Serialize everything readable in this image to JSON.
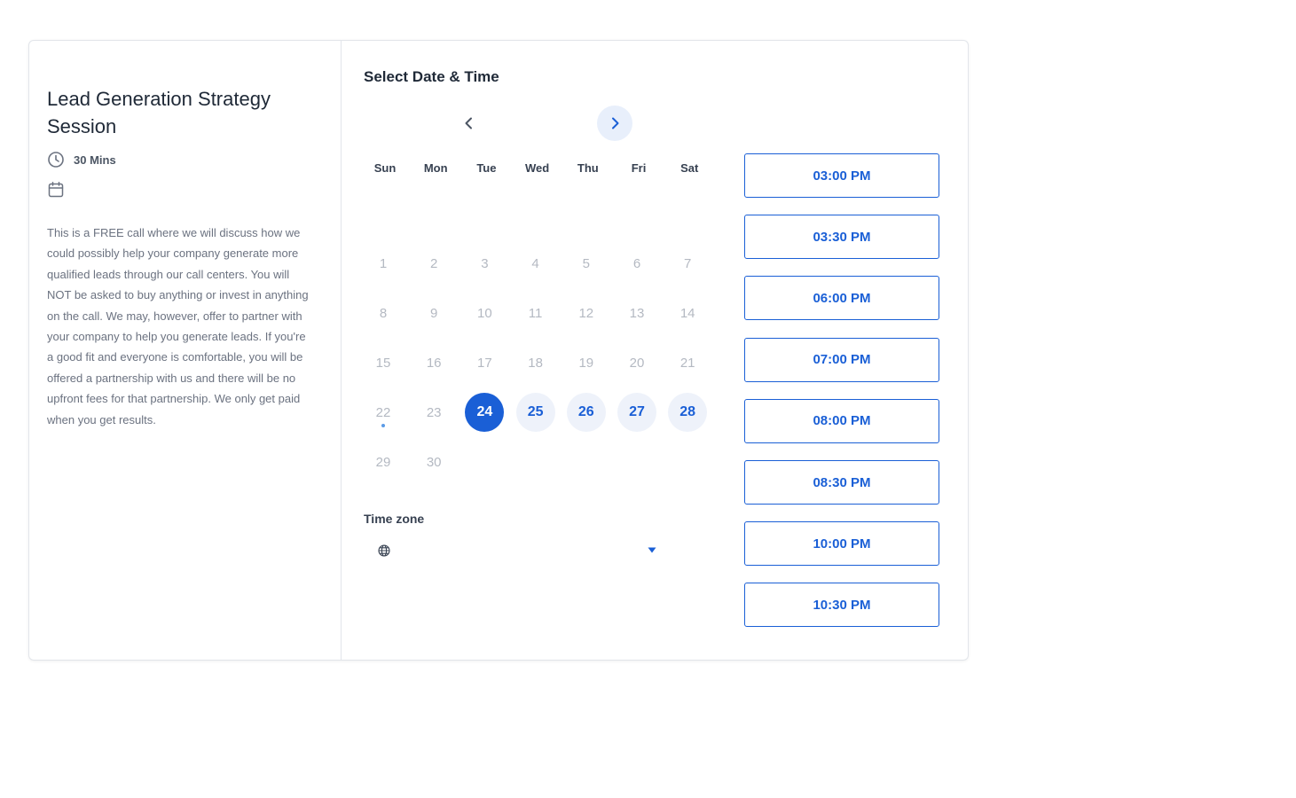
{
  "event": {
    "title": "Lead Generation Strategy Session",
    "duration": "30 Mins",
    "description": "This is a FREE call where we will discuss how we could possibly help your company generate more qualified leads through our call centers. You will NOT be asked to buy anything or invest in anything on the call. We may, however, offer to partner with your company to help you generate leads. If you're a good fit and everyone is comfortable, you will be offered a partnership with us and there will be no upfront fees for that partnership. We only get paid when you get results."
  },
  "scheduler": {
    "title": "Select Date & Time",
    "prev_icon": "chevron-left-icon",
    "next_icon": "chevron-right-icon"
  },
  "calendar": {
    "weekdays": [
      "Sun",
      "Mon",
      "Tue",
      "Wed",
      "Thu",
      "Fri",
      "Sat"
    ],
    "days": [
      "1",
      "2",
      "3",
      "4",
      "5",
      "6",
      "7",
      "8",
      "9",
      "10",
      "11",
      "12",
      "13",
      "14",
      "15",
      "16",
      "17",
      "18",
      "19",
      "20",
      "21",
      "22",
      "23",
      "24",
      "25",
      "26",
      "27",
      "28",
      "29",
      "30"
    ],
    "today": "22",
    "selected": "24",
    "available": [
      "25",
      "26",
      "27",
      "28"
    ],
    "colors": {
      "accent": "#1a5fd6",
      "available_bg": "#eef2fa",
      "disabled_text": "#b4b9c2"
    }
  },
  "timezone": {
    "label": "Time zone",
    "value": "",
    "icon": "globe-icon"
  },
  "slots": [
    "03:00 PM",
    "03:30 PM",
    "06:00 PM",
    "07:00 PM",
    "08:00 PM",
    "08:30 PM",
    "10:00 PM",
    "10:30 PM"
  ]
}
